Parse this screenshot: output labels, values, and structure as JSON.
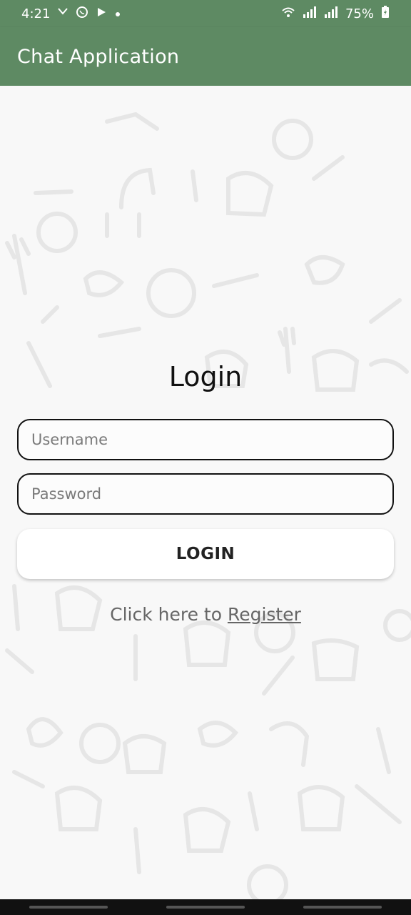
{
  "colors": {
    "accent": "#5e8a63"
  },
  "status_bar": {
    "time": "4:21",
    "icons": [
      "missed-call-icon",
      "whatsapp-icon",
      "play-store-icon",
      "dot-icon",
      "wifi-icon",
      "signal-icon",
      "signal-icon",
      "battery-charging-icon"
    ],
    "battery": "75%"
  },
  "app_bar": {
    "title": "Chat Application"
  },
  "login": {
    "title": "Login",
    "username_placeholder": "Username",
    "password_placeholder": "Password",
    "button_label": "LOGIN"
  },
  "register": {
    "prefix": "Click here to ",
    "link_label": "Register"
  }
}
